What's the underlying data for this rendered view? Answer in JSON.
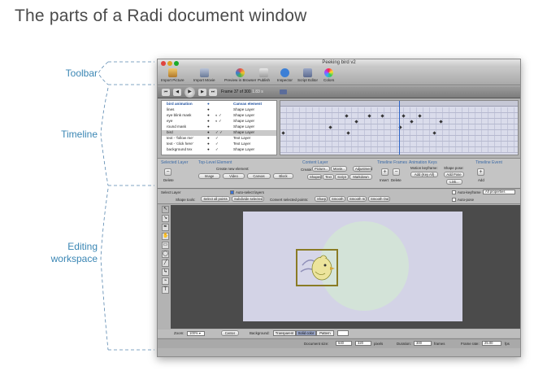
{
  "page": {
    "title": "The parts of a Radi document window"
  },
  "callouts": {
    "toolbar": "Toolbar",
    "timeline": "Timeline",
    "editing_line1": "Editing",
    "editing_line2": "workspace"
  },
  "window": {
    "title": "Peeking bird v2"
  },
  "toolbar_items": [
    "Import Picture",
    "Import Movie",
    "Preview in Browser",
    "Publish",
    "Inspector",
    "Script Editor",
    "Colors"
  ],
  "transport": {
    "frame_label": "Frame 37 of 300",
    "rate": "1.83 s"
  },
  "layers": [
    {
      "name": "bird animation",
      "type": "Canvas element"
    },
    {
      "name": "lines",
      "type": "Shape Layer"
    },
    {
      "name": "eye blink mask",
      "type": "Shape Layer"
    },
    {
      "name": "eye",
      "type": "Shape Layer"
    },
    {
      "name": "round mask",
      "type": "Shape Layer"
    },
    {
      "name": "bird",
      "type": "Shape Layer"
    },
    {
      "name": "text - 'follow me'",
      "type": "Text Layer"
    },
    {
      "name": "text - 'click here'",
      "type": "Text Layer"
    },
    {
      "name": "background tex",
      "type": "Shape Layer"
    }
  ],
  "panel": {
    "selected_layer": {
      "title": "Selected Layer",
      "delete": "Delete"
    },
    "top_level": {
      "title": "Top-Level Element",
      "create": "Create new element:",
      "image": "Image",
      "video": "Video",
      "canvas": "Canvas",
      "block": "Block"
    },
    "content_layer": {
      "title": "Content Layer",
      "create": "Create:",
      "picture": "Picture...",
      "movie": "Movie...",
      "adjustment": "Adjustment",
      "shapes": "Shapes",
      "text": "Text",
      "script": "Script",
      "markdown": "Markdown"
    },
    "timeline_frames": {
      "title": "Timeline Frames",
      "insert": "Insert",
      "delete": "Delete"
    },
    "animation_keys": {
      "title": "Animation Keys",
      "motion": "Motion keyframe:",
      "shape": "Shape pose:",
      "add_key": "Add (Key All)",
      "add_pose": "Add Pose",
      "link": "Link..."
    },
    "timeline_event": {
      "title": "Timeline Event",
      "add": "Add"
    }
  },
  "edit_bar": {
    "select_layer": "Select Layer",
    "auto_select": "Auto-select layers",
    "auto_keyframe": "Auto-keyframe",
    "auto_keyframe_option": "All properties",
    "auto_pose": "Auto-pose",
    "shape_tools": "Shape tools:",
    "select_all": "Select all points",
    "subdivide": "Subdivide selected",
    "convert": "Convert selected points:",
    "sharp": "Sharp",
    "smooth": "Smooth",
    "smooth_in": "Smooth In",
    "smooth_out": "Smooth Out"
  },
  "bottom": {
    "zoom_label": "Zoom:",
    "zoom_value": "100% ▾",
    "center": "Center",
    "background": "Background:",
    "transparent": "Transparent",
    "solid": "Solid color",
    "pattern": "Pattern",
    "doc_size": "Document size:",
    "width": "640",
    "height": "320",
    "pixels": "pixels",
    "duration": "Duration:",
    "duration_value": "300",
    "frames": "frames",
    "frame_rate": "Frame rate:",
    "fps_value": "25.00",
    "fps": "fps"
  },
  "colors": {
    "accent": "#3a86b4",
    "selection": "#8a7b25",
    "canvas": "#d3d3e6",
    "circle": "#d3e3d8",
    "bird": "#ece49c"
  }
}
